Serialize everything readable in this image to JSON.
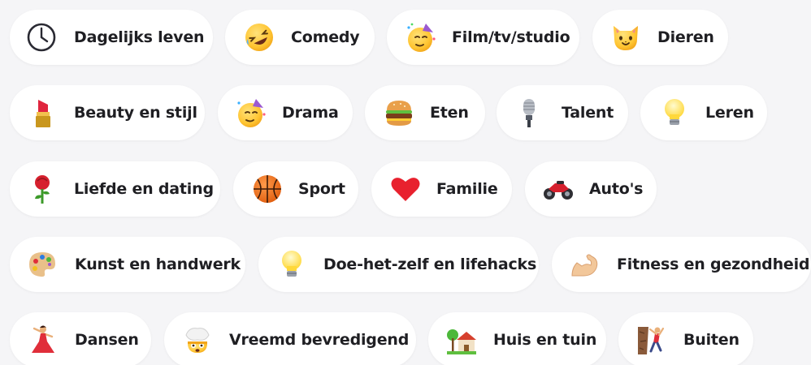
{
  "categories": [
    {
      "label": "Dagelijks leven",
      "icon": "clock-icon"
    },
    {
      "label": "Comedy",
      "icon": "rolling-on-floor-laughing-icon"
    },
    {
      "label": "Film/tv/studio",
      "icon": "partying-face-icon"
    },
    {
      "label": "Dieren",
      "icon": "cat-face-icon"
    },
    {
      "label": "Beauty en stijl",
      "icon": "lipstick-icon"
    },
    {
      "label": "Drama",
      "icon": "partying-face-icon"
    },
    {
      "label": "Eten",
      "icon": "hamburger-icon"
    },
    {
      "label": "Talent",
      "icon": "microphone-icon"
    },
    {
      "label": "Leren",
      "icon": "light-bulb-icon"
    },
    {
      "label": "Liefde en dating",
      "icon": "rose-icon"
    },
    {
      "label": "Sport",
      "icon": "basketball-icon"
    },
    {
      "label": "Familie",
      "icon": "red-heart-icon"
    },
    {
      "label": "Auto's",
      "icon": "motorcycle-icon"
    },
    {
      "label": "Kunst en handwerk",
      "icon": "artist-palette-icon"
    },
    {
      "label": "Doe-het-zelf en lifehacks",
      "icon": "light-bulb-icon"
    },
    {
      "label": "Fitness en gezondheid",
      "icon": "flexed-biceps-icon"
    },
    {
      "label": "Dansen",
      "icon": "woman-dancing-icon"
    },
    {
      "label": "Vreemd bevredigend",
      "icon": "exploding-head-icon"
    },
    {
      "label": "Huis en tuin",
      "icon": "house-with-garden-icon"
    },
    {
      "label": "Buiten",
      "icon": "person-climbing-icon"
    }
  ],
  "colors": {
    "background": "#f5f5f7",
    "chip": "#ffffff",
    "text": "#1f1f23"
  }
}
